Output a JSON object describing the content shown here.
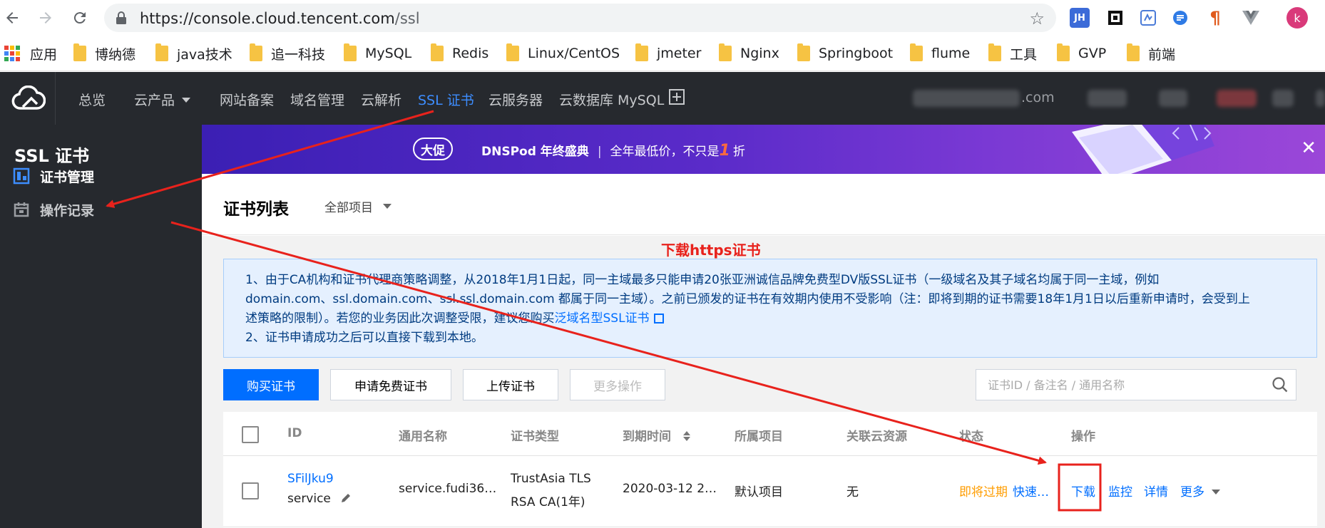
{
  "browser": {
    "url_host": "https://console.cloud.tencent.com",
    "url_path": "/ssl",
    "extension_badges": [
      "JH",
      "k"
    ]
  },
  "bookmarks": {
    "apps_label": "应用",
    "folders": [
      "博纳德",
      "java技术",
      "追一科技",
      "MySQL",
      "Redis",
      "Linux/CentOS",
      "jmeter",
      "Nginx",
      "Springboot",
      "flume",
      "工具",
      "GVP",
      "前端"
    ]
  },
  "topnav": {
    "items": [
      "总览",
      "云产品",
      "网站备案",
      "域名管理",
      "云解析",
      "SSL 证书",
      "云服务器",
      "云数据库 MySQL"
    ],
    "active": "SSL 证书",
    "account_blurred": ".com"
  },
  "sidebar": {
    "title": "SSL 证书",
    "items": [
      "证书管理",
      "操作记录"
    ],
    "active": "证书管理"
  },
  "banner": {
    "pill": "大促",
    "brand": "DNSPod 年终盛典",
    "separator": "|",
    "promo_prefix": "全年最低价，不只是",
    "promo_number": "1",
    "promo_suffix": "折"
  },
  "page": {
    "title": "证书列表",
    "project_select": "全部项目"
  },
  "annotation": {
    "label": "下载https证书",
    "color": "#e8221c"
  },
  "notice": {
    "line1": "1、由于CA机构和证书代理商策略调整，从2018年1月1日起，同一主域最多只能申请20张亚洲诚信品牌免费型DV版SSL证书（一级域名及其子域名均属于同一主域，例如",
    "line2": "domain.com、ssl.domain.com、ssl.ssl.domain.com 都属于同一主域）。之前已颁发的证书在有效期内使用不受影响（注：即将到期的证书需要18年1月1日以后重新申请时，会受到上",
    "line3_prefix": "述策略的限制）。若您的业务因此次调整受限，建议您购买",
    "line3_link": "泛域名型SSL证书",
    "line4": "2、证书申请成功之后可以直接下载到本地。"
  },
  "toolbar": {
    "buy": "购买证书",
    "apply_free": "申请免费证书",
    "upload": "上传证书",
    "more_ops": "更多操作",
    "search_placeholder": "证书ID / 备注名 / 通用名称"
  },
  "table": {
    "headers": [
      "ID",
      "通用名称",
      "证书类型",
      "到期时间",
      "所属项目",
      "关联云资源",
      "状态",
      "操作"
    ],
    "rows": [
      {
        "id": "SFilJku9",
        "remark": "service",
        "common_name": "service.fudi36…",
        "cert_type_line1": "TrustAsia TLS",
        "cert_type_line2": "RSA CA(1年)",
        "expire": "2020-03-12 2…",
        "project": "默认项目",
        "resources": "无",
        "status": "即将过期",
        "status_link": "快速…",
        "actions": [
          "下载",
          "监控",
          "详情",
          "更多"
        ]
      }
    ]
  },
  "colors": {
    "accent": "#006eff",
    "nav_active": "#3d8dff",
    "warning": "#ff9d00",
    "dark_bg": "#26292e"
  }
}
